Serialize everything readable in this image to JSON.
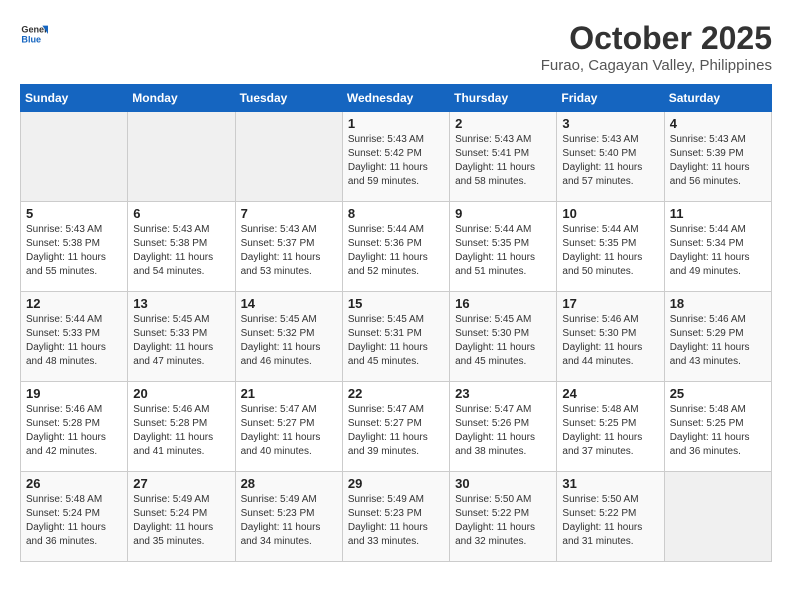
{
  "logo": {
    "line1": "General",
    "line2": "Blue"
  },
  "title": "October 2025",
  "subtitle": "Furao, Cagayan Valley, Philippines",
  "headers": [
    "Sunday",
    "Monday",
    "Tuesday",
    "Wednesday",
    "Thursday",
    "Friday",
    "Saturday"
  ],
  "weeks": [
    [
      {
        "day": "",
        "info": ""
      },
      {
        "day": "",
        "info": ""
      },
      {
        "day": "",
        "info": ""
      },
      {
        "day": "1",
        "info": "Sunrise: 5:43 AM\nSunset: 5:42 PM\nDaylight: 11 hours\nand 59 minutes."
      },
      {
        "day": "2",
        "info": "Sunrise: 5:43 AM\nSunset: 5:41 PM\nDaylight: 11 hours\nand 58 minutes."
      },
      {
        "day": "3",
        "info": "Sunrise: 5:43 AM\nSunset: 5:40 PM\nDaylight: 11 hours\nand 57 minutes."
      },
      {
        "day": "4",
        "info": "Sunrise: 5:43 AM\nSunset: 5:39 PM\nDaylight: 11 hours\nand 56 minutes."
      }
    ],
    [
      {
        "day": "5",
        "info": "Sunrise: 5:43 AM\nSunset: 5:38 PM\nDaylight: 11 hours\nand 55 minutes."
      },
      {
        "day": "6",
        "info": "Sunrise: 5:43 AM\nSunset: 5:38 PM\nDaylight: 11 hours\nand 54 minutes."
      },
      {
        "day": "7",
        "info": "Sunrise: 5:43 AM\nSunset: 5:37 PM\nDaylight: 11 hours\nand 53 minutes."
      },
      {
        "day": "8",
        "info": "Sunrise: 5:44 AM\nSunset: 5:36 PM\nDaylight: 11 hours\nand 52 minutes."
      },
      {
        "day": "9",
        "info": "Sunrise: 5:44 AM\nSunset: 5:35 PM\nDaylight: 11 hours\nand 51 minutes."
      },
      {
        "day": "10",
        "info": "Sunrise: 5:44 AM\nSunset: 5:35 PM\nDaylight: 11 hours\nand 50 minutes."
      },
      {
        "day": "11",
        "info": "Sunrise: 5:44 AM\nSunset: 5:34 PM\nDaylight: 11 hours\nand 49 minutes."
      }
    ],
    [
      {
        "day": "12",
        "info": "Sunrise: 5:44 AM\nSunset: 5:33 PM\nDaylight: 11 hours\nand 48 minutes."
      },
      {
        "day": "13",
        "info": "Sunrise: 5:45 AM\nSunset: 5:33 PM\nDaylight: 11 hours\nand 47 minutes."
      },
      {
        "day": "14",
        "info": "Sunrise: 5:45 AM\nSunset: 5:32 PM\nDaylight: 11 hours\nand 46 minutes."
      },
      {
        "day": "15",
        "info": "Sunrise: 5:45 AM\nSunset: 5:31 PM\nDaylight: 11 hours\nand 45 minutes."
      },
      {
        "day": "16",
        "info": "Sunrise: 5:45 AM\nSunset: 5:30 PM\nDaylight: 11 hours\nand 45 minutes."
      },
      {
        "day": "17",
        "info": "Sunrise: 5:46 AM\nSunset: 5:30 PM\nDaylight: 11 hours\nand 44 minutes."
      },
      {
        "day": "18",
        "info": "Sunrise: 5:46 AM\nSunset: 5:29 PM\nDaylight: 11 hours\nand 43 minutes."
      }
    ],
    [
      {
        "day": "19",
        "info": "Sunrise: 5:46 AM\nSunset: 5:28 PM\nDaylight: 11 hours\nand 42 minutes."
      },
      {
        "day": "20",
        "info": "Sunrise: 5:46 AM\nSunset: 5:28 PM\nDaylight: 11 hours\nand 41 minutes."
      },
      {
        "day": "21",
        "info": "Sunrise: 5:47 AM\nSunset: 5:27 PM\nDaylight: 11 hours\nand 40 minutes."
      },
      {
        "day": "22",
        "info": "Sunrise: 5:47 AM\nSunset: 5:27 PM\nDaylight: 11 hours\nand 39 minutes."
      },
      {
        "day": "23",
        "info": "Sunrise: 5:47 AM\nSunset: 5:26 PM\nDaylight: 11 hours\nand 38 minutes."
      },
      {
        "day": "24",
        "info": "Sunrise: 5:48 AM\nSunset: 5:25 PM\nDaylight: 11 hours\nand 37 minutes."
      },
      {
        "day": "25",
        "info": "Sunrise: 5:48 AM\nSunset: 5:25 PM\nDaylight: 11 hours\nand 36 minutes."
      }
    ],
    [
      {
        "day": "26",
        "info": "Sunrise: 5:48 AM\nSunset: 5:24 PM\nDaylight: 11 hours\nand 36 minutes."
      },
      {
        "day": "27",
        "info": "Sunrise: 5:49 AM\nSunset: 5:24 PM\nDaylight: 11 hours\nand 35 minutes."
      },
      {
        "day": "28",
        "info": "Sunrise: 5:49 AM\nSunset: 5:23 PM\nDaylight: 11 hours\nand 34 minutes."
      },
      {
        "day": "29",
        "info": "Sunrise: 5:49 AM\nSunset: 5:23 PM\nDaylight: 11 hours\nand 33 minutes."
      },
      {
        "day": "30",
        "info": "Sunrise: 5:50 AM\nSunset: 5:22 PM\nDaylight: 11 hours\nand 32 minutes."
      },
      {
        "day": "31",
        "info": "Sunrise: 5:50 AM\nSunset: 5:22 PM\nDaylight: 11 hours\nand 31 minutes."
      },
      {
        "day": "",
        "info": ""
      }
    ]
  ]
}
